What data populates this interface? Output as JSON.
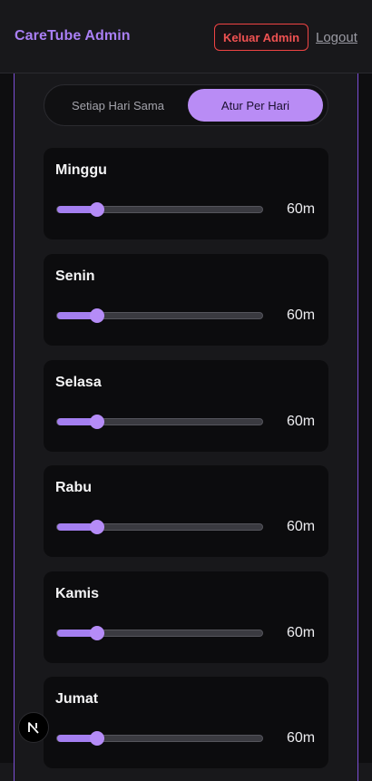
{
  "header": {
    "title": "CareTube Admin",
    "exit_admin_label": "Keluar Admin",
    "logout_label": "Logout"
  },
  "schedule_mode": {
    "options": [
      "Setiap Hari Sama",
      "Atur Per Hari"
    ],
    "selected": "Atur Per Hari"
  },
  "slider_range": {
    "min": 0,
    "max": 360
  },
  "days": [
    {
      "name": "Minggu",
      "minutes": 60,
      "value_label": "60m"
    },
    {
      "name": "Senin",
      "minutes": 60,
      "value_label": "60m"
    },
    {
      "name": "Selasa",
      "minutes": 60,
      "value_label": "60m"
    },
    {
      "name": "Rabu",
      "minutes": 60,
      "value_label": "60m"
    },
    {
      "name": "Kamis",
      "minutes": 60,
      "value_label": "60m"
    },
    {
      "name": "Jumat",
      "minutes": 60,
      "value_label": "60m"
    }
  ],
  "colors": {
    "accent": "#b98cf5",
    "title": "#a97ff5",
    "danger": "#ef4444"
  },
  "dev_badge": {
    "icon": "nextjs-logo-icon"
  }
}
